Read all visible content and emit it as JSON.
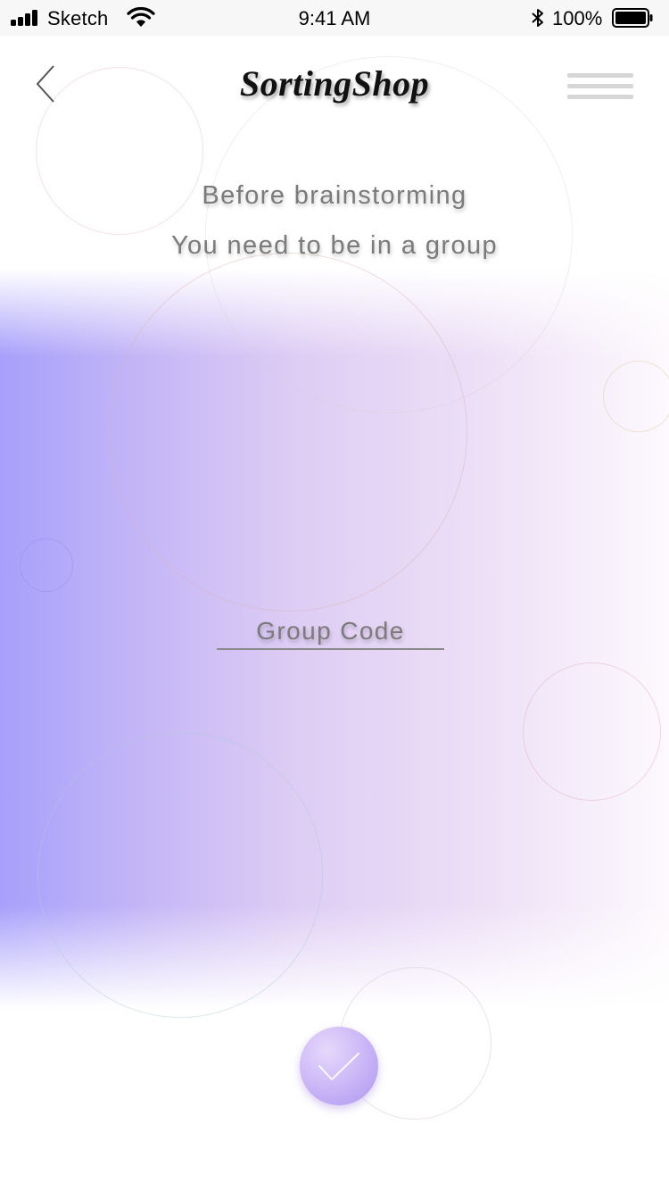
{
  "status_bar": {
    "carrier": "Sketch",
    "time": "9:41 AM",
    "battery_percent": "100%",
    "battery_level": 1.0,
    "icons": [
      "signal-bars-icon",
      "wifi-icon",
      "bluetooth-icon",
      "battery-icon"
    ]
  },
  "nav": {
    "back_icon": "chevron-left-icon",
    "brand": "SortingShop",
    "menu_icon": "hamburger-menu-icon"
  },
  "headline": {
    "line1": "Before brainstorming",
    "line2": "You need to be in a group"
  },
  "group_code": {
    "value": "",
    "placeholder": "Group Code"
  },
  "submit": {
    "icon": "checkmark-icon"
  },
  "colors": {
    "gradient_left": "#a7a0fb",
    "gradient_right": "#fdf9fd",
    "text": "#7b7b7b",
    "brand": "#111111",
    "submit_button": "#c8b4f6",
    "status_bar_bg": "#f7f7f7"
  }
}
